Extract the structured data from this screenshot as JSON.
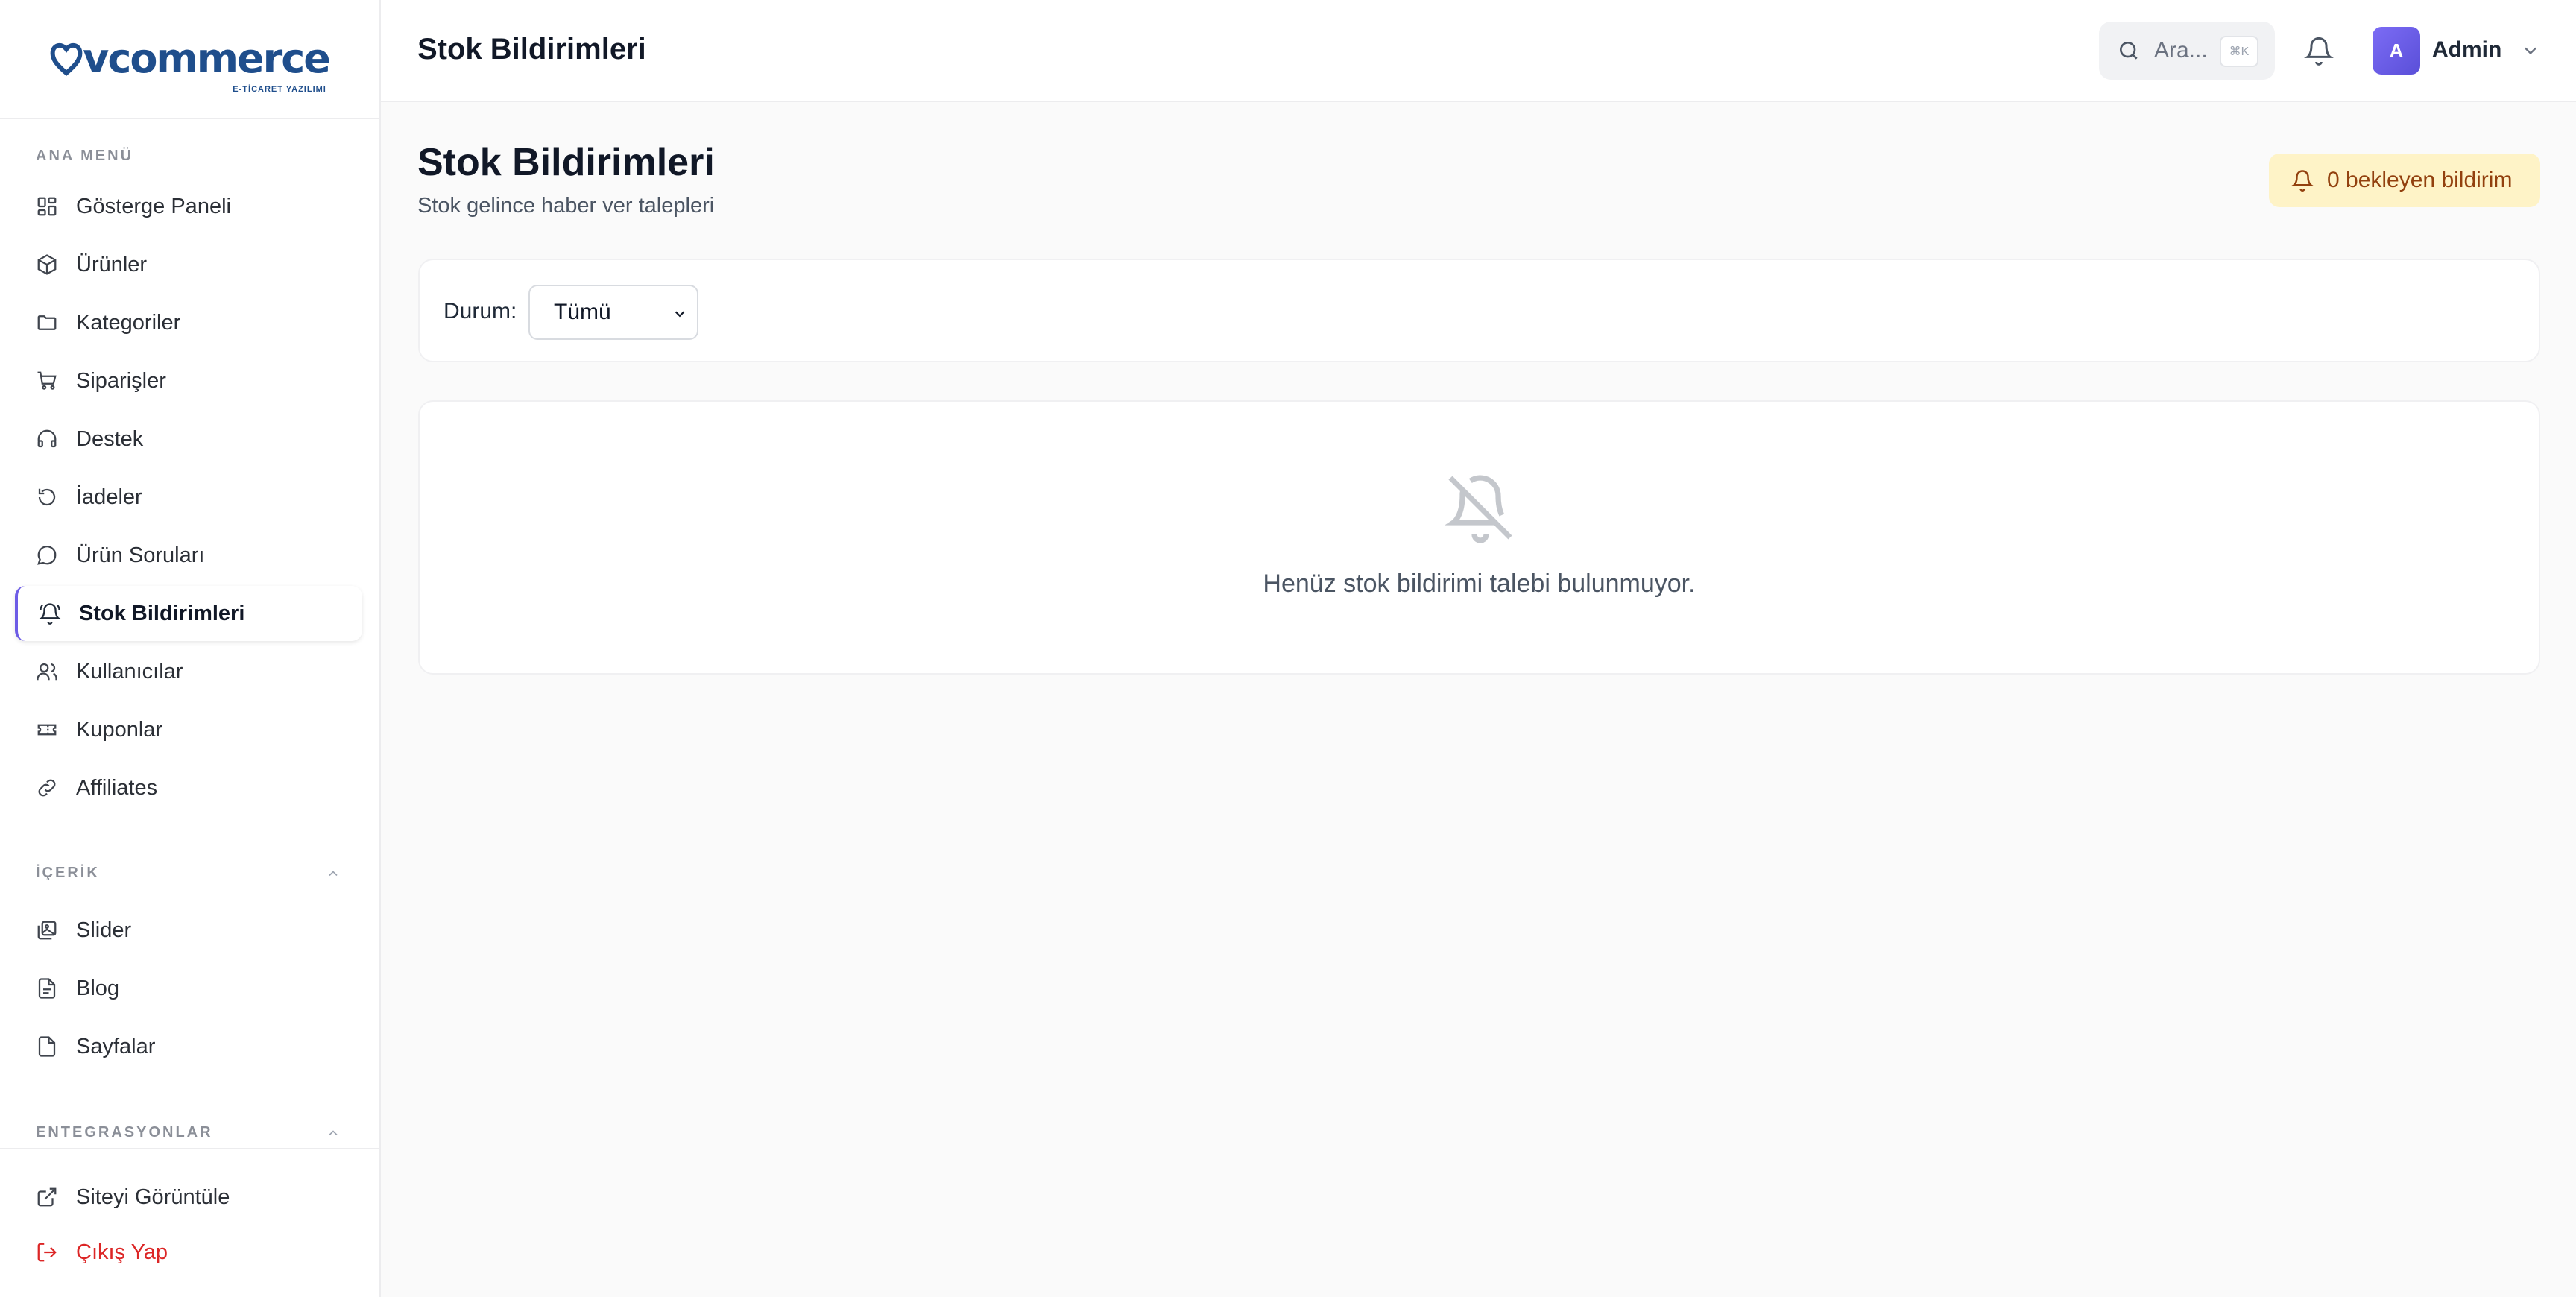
{
  "brand": {
    "logo_text": "vcommerce",
    "logo_sub": "E-TİCARET YAZILIMI"
  },
  "header": {
    "title": "Stok Bildirimleri",
    "search_placeholder": "Ara...",
    "search_shortcut": "⌘K",
    "user_initial": "A",
    "user_name": "Admin"
  },
  "sidebar": {
    "main_section": "ANA MENÜ",
    "items": [
      {
        "label": "Gösterge Paneli",
        "icon": "dashboard-icon"
      },
      {
        "label": "Ürünler",
        "icon": "package-icon"
      },
      {
        "label": "Kategoriler",
        "icon": "folder-icon"
      },
      {
        "label": "Siparişler",
        "icon": "cart-icon"
      },
      {
        "label": "Destek",
        "icon": "headphones-icon"
      },
      {
        "label": "İadeler",
        "icon": "return-icon"
      },
      {
        "label": "Ürün Soruları",
        "icon": "message-icon"
      },
      {
        "label": "Stok Bildirimleri",
        "icon": "bell-ring-icon",
        "active": true
      },
      {
        "label": "Kullanıcılar",
        "icon": "users-icon"
      },
      {
        "label": "Kuponlar",
        "icon": "ticket-icon"
      },
      {
        "label": "Affiliates",
        "icon": "link-icon"
      }
    ],
    "content_section": "İÇERİK",
    "content_items": [
      {
        "label": "Slider",
        "icon": "images-icon"
      },
      {
        "label": "Blog",
        "icon": "file-text-icon"
      },
      {
        "label": "Sayfalar",
        "icon": "file-icon"
      }
    ],
    "integrations_section": "ENTEGRASYONLAR",
    "bottom_items": [
      {
        "label": "Siteyi Görüntüle",
        "icon": "external-link-icon"
      },
      {
        "label": "Çıkış Yap",
        "icon": "logout-icon"
      }
    ]
  },
  "main": {
    "title": "Stok Bildirimleri",
    "subtitle": "Stok gelince haber ver talepleri",
    "pending_badge": "0 bekleyen bildirim",
    "filter_label": "Durum:",
    "filter_value": "Tümü",
    "empty_message": "Henüz stok bildirimi talebi bulunmuyor."
  },
  "colors": {
    "accent": "#6d5ce6",
    "badge_bg": "#fef3c7",
    "badge_text": "#92400e",
    "danger": "#dc2626",
    "brand": "#1f4e8c"
  }
}
